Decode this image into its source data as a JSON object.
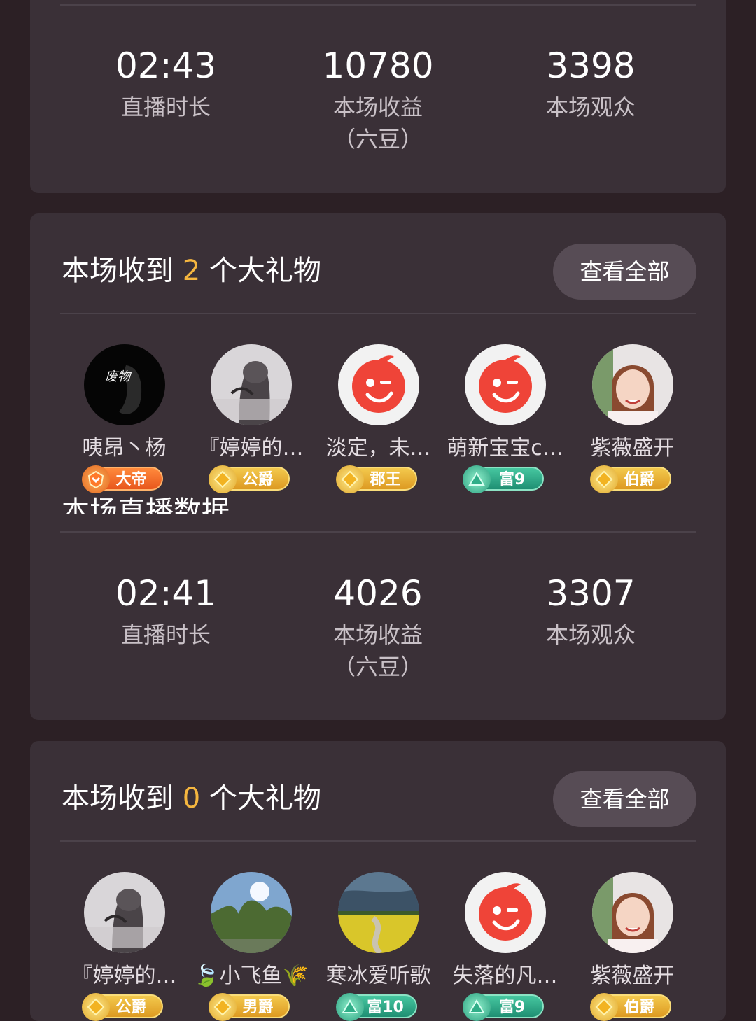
{
  "stats_top": [
    {
      "value": "02:43",
      "label": "直播时长"
    },
    {
      "value": "10780",
      "label": "本场收益\n（六豆）"
    },
    {
      "value": "3398",
      "label": "本场观众"
    }
  ],
  "gifts_1": {
    "prefix": "本场收到 ",
    "count": "2",
    "suffix": " 个大礼物",
    "view_all": "查看全部",
    "gifters": [
      {
        "name": "咦昂丶杨",
        "badge": "大帝",
        "badge_style": "orange",
        "avatar": "dark-portrait"
      },
      {
        "name": "『婷婷的…",
        "badge": "公爵",
        "badge_style": "gold",
        "avatar": "girl-sketch"
      },
      {
        "name": "淡定，未…",
        "badge": "郡王",
        "badge_style": "gold",
        "avatar": "default-red"
      },
      {
        "name": "萌新宝宝c…",
        "badge": "富9",
        "badge_style": "teal",
        "avatar": "default-red"
      },
      {
        "name": "紫薇盛开",
        "badge": "伯爵",
        "badge_style": "gold",
        "avatar": "woman-photo"
      }
    ]
  },
  "overlap_title": "本场直播数据",
  "stats_second": [
    {
      "value": "02:41",
      "label": "直播时长"
    },
    {
      "value": "4026",
      "label": "本场收益\n（六豆）"
    },
    {
      "value": "3307",
      "label": "本场观众"
    }
  ],
  "gifts_2": {
    "prefix": "本场收到 ",
    "count": "0",
    "suffix": " 个大礼物",
    "view_all": "查看全部",
    "gifters": [
      {
        "name": "『婷婷的…",
        "badge": "公爵",
        "badge_style": "gold",
        "avatar": "girl-sketch"
      },
      {
        "name": "🍃小飞鱼🌾",
        "badge": "男爵",
        "badge_style": "gold",
        "avatar": "trees-photo"
      },
      {
        "name": "寒冰爱听歌",
        "badge": "富10",
        "badge_style": "teal",
        "avatar": "field-photo"
      },
      {
        "name": "失落的凡…",
        "badge": "富9",
        "badge_style": "teal",
        "avatar": "default-red"
      },
      {
        "name": "紫薇盛开",
        "badge": "伯爵",
        "badge_style": "gold",
        "avatar": "woman-photo"
      }
    ]
  },
  "colors": {
    "accent": "#f5b63f",
    "card": "#3a3037",
    "background": "#2c2025"
  }
}
